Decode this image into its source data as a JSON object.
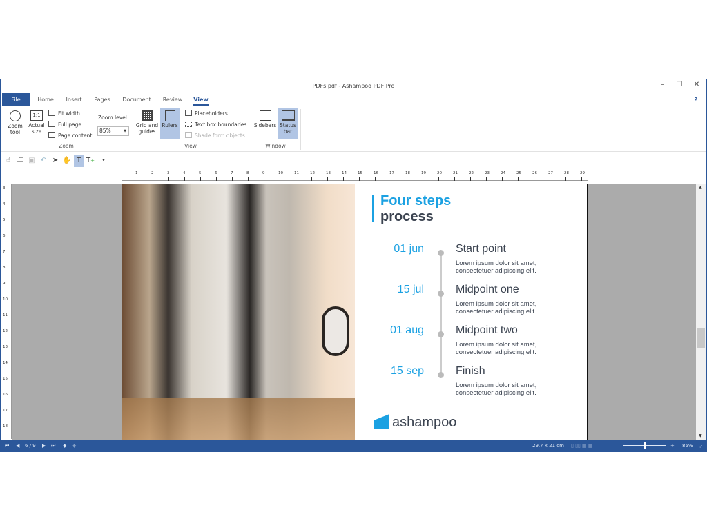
{
  "window": {
    "title": "PDFs.pdf - Ashampoo PDF Pro",
    "minimize": "–",
    "maximize": "☐",
    "close": "✕",
    "help": "?"
  },
  "tabs": [
    "File",
    "Home",
    "Insert",
    "Pages",
    "Document",
    "Review",
    "View"
  ],
  "ribbon": {
    "zoom_tool": "Zoom tool",
    "actual_size": "Actual size",
    "actual_icon": "1:1",
    "fit_width": "Fit width",
    "full_page": "Full page",
    "page_content": "Page content",
    "zoom_level_label": "Zoom level:",
    "zoom_level_value": "85%",
    "zoom_group": "Zoom",
    "grid_guides": "Grid and guides",
    "rulers": "Rulers",
    "placeholders": "Placeholders",
    "text_box_boundaries": "Text box boundaries",
    "shade_form_objects": "Shade form objects",
    "view_group": "View",
    "sidebars": "Sidebars",
    "status_bar": "Status bar",
    "window_group": "Window"
  },
  "rulers": {
    "top": [
      "1",
      "2",
      "3",
      "4",
      "5",
      "6",
      "7",
      "8",
      "9",
      "10",
      "11",
      "12",
      "13",
      "14",
      "15",
      "16",
      "17",
      "18",
      "19",
      "20",
      "21",
      "22",
      "23",
      "24",
      "25",
      "26",
      "27",
      "28",
      "29"
    ],
    "left": [
      "3",
      "4",
      "5",
      "6",
      "7",
      "8",
      "9",
      "10",
      "11",
      "12",
      "13",
      "14",
      "15",
      "16",
      "17",
      "18"
    ]
  },
  "document": {
    "title_line1": "Four steps",
    "title_line2": "process",
    "steps": [
      {
        "date": "01 jun",
        "title": "Start point",
        "desc1": "Lorem ipsum dolor sit amet,",
        "desc2": "consectetuer adipiscing elit."
      },
      {
        "date": "15 jul",
        "title": "Midpoint one",
        "desc1": "Lorem ipsum dolor sit amet,",
        "desc2": "consectetuer adipiscing elit."
      },
      {
        "date": "01 aug",
        "title": "Midpoint two",
        "desc1": "Lorem ipsum dolor sit amet,",
        "desc2": "consectetuer adipiscing elit."
      },
      {
        "date": "15 sep",
        "title": "Finish",
        "desc1": "Lorem ipsum dolor sit amet,",
        "desc2": "consectetuer adipiscing elit."
      }
    ],
    "logo": "ashampoo"
  },
  "statusbar": {
    "page": "6 / 9",
    "size": "29.7 x 21 cm",
    "zoom": "85%",
    "zoom_fraction": 0.5
  },
  "colors": {
    "accent": "#2b579a",
    "brand": "#1ba1e2"
  }
}
